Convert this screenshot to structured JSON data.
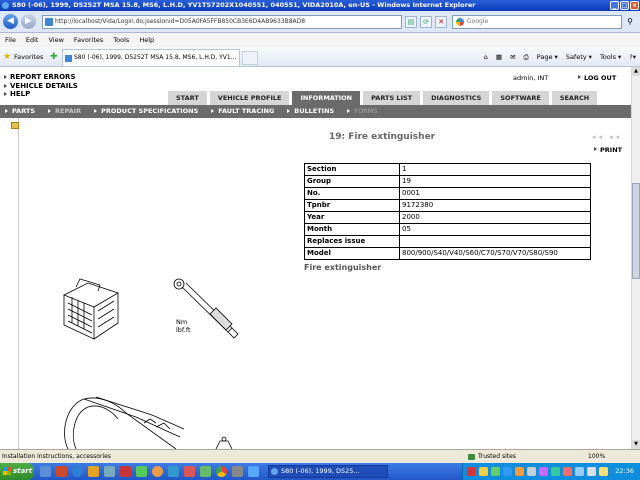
{
  "window": {
    "title": "S80 (-06), 1999, D5252T MSA 15.8, MS6, L.H.D, YV1TS7202X1040551, 040551, VIDA2010A, en-US - Windows Internet Explorer",
    "min": "_",
    "max": "□",
    "close": "x"
  },
  "browser": {
    "url": "http://localhost/Vida/Login.do;jsessionid=D05A0FA5FFB850CB3E6D4AB9633B8AD8",
    "search_placeholder": "Google",
    "menu": [
      "File",
      "Edit",
      "View",
      "Favorites",
      "Tools",
      "Help"
    ],
    "favorites_label": "Favorites",
    "tab_title": "S80 (-06), 1999, D5252T MSA 15.8, MS6, L.H.D, YV1...",
    "commands": [
      "Page ▾",
      "Safety ▾",
      "Tools ▾",
      "?▾"
    ]
  },
  "app": {
    "left_links": [
      "REPORT ERRORS",
      "VEHICLE DETAILS",
      "HELP"
    ],
    "user": "admin, INT",
    "logout": "LOG OUT",
    "main_tabs": [
      "START",
      "VEHICLE PROFILE",
      "INFORMATION",
      "PARTS LIST",
      "DIAGNOSTICS",
      "SOFTWARE",
      "SEARCH"
    ],
    "active_main_tab": "INFORMATION",
    "sub_nav": [
      "PARTS",
      "REPAIR",
      "PRODUCT SPECIFICATIONS",
      "FAULT TRACING",
      "BULLETINS",
      "FORMS"
    ],
    "active_sub_nav": "REPAIR",
    "disabled_sub_nav": "FORMS"
  },
  "document": {
    "title": "19: Fire extinguisher",
    "print_label": "PRINT",
    "pager": "◂◂ ▸▸",
    "info_rows": [
      {
        "key": "Section",
        "value": "1"
      },
      {
        "key": "Group",
        "value": "19"
      },
      {
        "key": "No.",
        "value": "0001"
      },
      {
        "key": "Tpnbr",
        "value": "9172380"
      },
      {
        "key": "Year",
        "value": "2000"
      },
      {
        "key": "Month",
        "value": "05"
      },
      {
        "key": "Replaces issue",
        "value": ""
      },
      {
        "key": "Model",
        "value": "800/900/S40/V40/S60/C70/S70/V70/S80/S90"
      }
    ],
    "subheading": "Fire extinguisher",
    "torque_units": [
      "Nm",
      "lbf.ft"
    ]
  },
  "status": {
    "message": "Installation instructions, accessories",
    "zone": "Trusted sites",
    "zoom": "100%"
  },
  "taskbar": {
    "start": "start",
    "app": "S80 (-06), 1999, D525...",
    "clock": "22:36"
  },
  "colors": {
    "nav_dark": "#6b6b6b",
    "tab_light": "#d5d5d5",
    "title_blue": "#0b3ab8"
  }
}
